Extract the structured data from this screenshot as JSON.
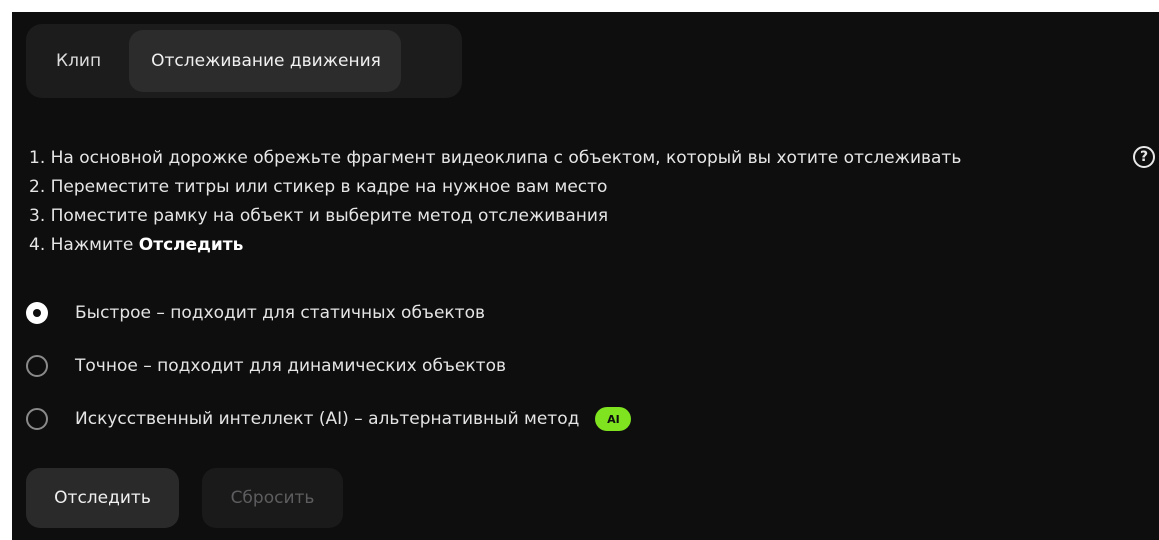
{
  "tabs": {
    "clip": "Клип",
    "motion_tracking": "Отслеживание движения"
  },
  "instructions": {
    "step1": "1. На основной дорожке обрежьте фрагмент видеоклипа с объектом, который вы хотите отслеживать",
    "step2": "2. Переместите титры или стикер в кадре на нужное вам место",
    "step3": "3. Поместите рамку на объект и выберите метод отслеживания",
    "step4_prefix": "4. Нажмите ",
    "step4_bold": "Отследить"
  },
  "help_icon_glyph": "?",
  "methods": {
    "fast": "Быстрое – подходит для статичных объектов",
    "precise": "Точное – подходит для динамических объектов",
    "ai": "Искусственный интеллект (AI) – альтернативный метод",
    "ai_badge": "AI",
    "selected": "fast"
  },
  "buttons": {
    "track": "Отследить",
    "reset": "Сбросить"
  },
  "colors": {
    "panel_bg": "#0e0e0f",
    "ai_badge": "#7fe320"
  },
  "icons": {
    "help": "question-circle-icon",
    "radio_checked": "radio-checked-icon",
    "radio_unchecked": "radio-unchecked-icon"
  }
}
